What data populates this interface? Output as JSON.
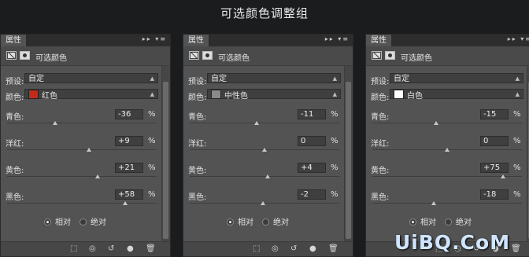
{
  "page_title": "可选颜色调整组",
  "panels": [
    {
      "tab": "属性",
      "header_title": "可选颜色",
      "preset_label": "预设:",
      "preset_value": "自定",
      "colors_label": "颜色:",
      "color_value": "红色",
      "color_swatch": "#c32a1a",
      "sliders": [
        {
          "label": "青色:",
          "value": "-36",
          "pct": "%"
        },
        {
          "label": "洋红:",
          "value": "+9",
          "pct": "%"
        },
        {
          "label": "黄色:",
          "value": "+21",
          "pct": "%"
        },
        {
          "label": "黑色:",
          "value": "+58",
          "pct": "%"
        }
      ],
      "radio_relative": "相对",
      "radio_absolute": "绝对"
    },
    {
      "tab": "属性",
      "header_title": "可选颜色",
      "preset_label": "预设:",
      "preset_value": "自定",
      "colors_label": "颜色:",
      "color_value": "中性色",
      "color_swatch": "#8a8a8a",
      "sliders": [
        {
          "label": "青色:",
          "value": "-11",
          "pct": "%"
        },
        {
          "label": "洋红:",
          "value": "0",
          "pct": "%"
        },
        {
          "label": "黄色:",
          "value": "+4",
          "pct": "%"
        },
        {
          "label": "黑色:",
          "value": "-2",
          "pct": "%"
        }
      ],
      "radio_relative": "相对",
      "radio_absolute": "绝对"
    },
    {
      "tab": "属性",
      "header_title": "可选颜色",
      "preset_label": "预设:",
      "preset_value": "自定",
      "colors_label": "颜色:",
      "color_value": "白色",
      "color_swatch": "#ffffff",
      "sliders": [
        {
          "label": "青色:",
          "value": "-15",
          "pct": "%"
        },
        {
          "label": "洋红:",
          "value": "0",
          "pct": "%"
        },
        {
          "label": "黄色:",
          "value": "+75",
          "pct": "%"
        },
        {
          "label": "黑色:",
          "value": "-18",
          "pct": "%"
        }
      ],
      "radio_relative": "相对",
      "radio_absolute": "绝对"
    }
  ],
  "watermark": "UiBQ.CoM"
}
